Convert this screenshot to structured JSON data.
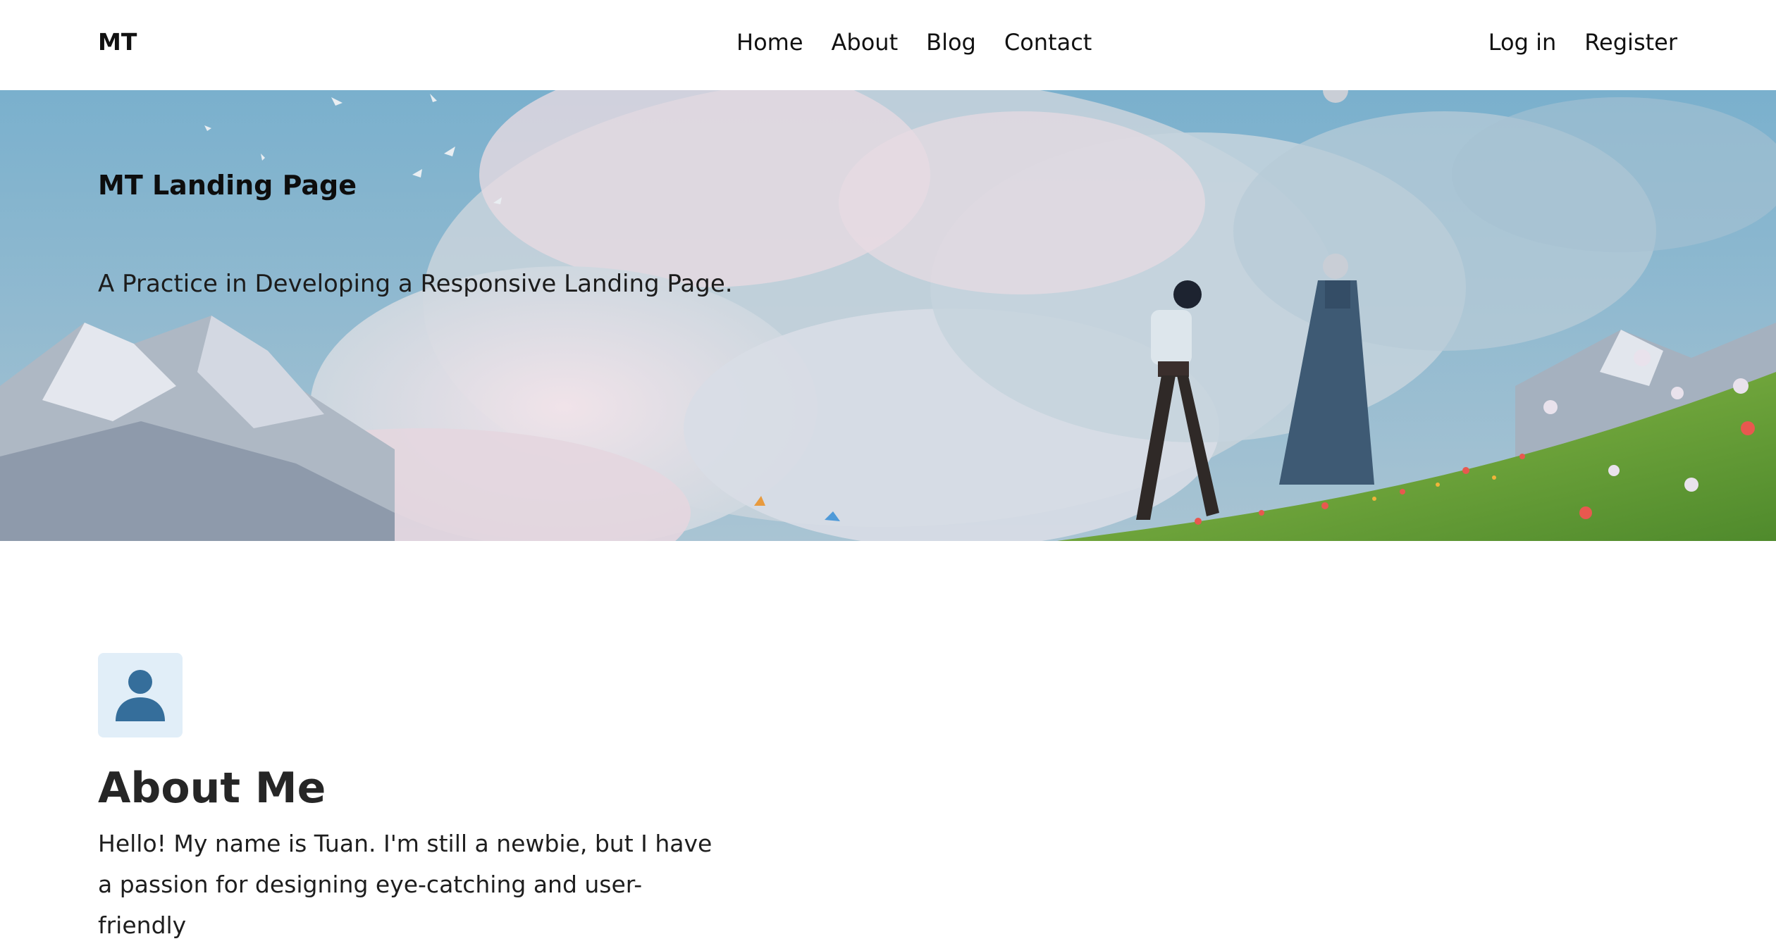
{
  "nav": {
    "brand": "MT",
    "links": [
      "Home",
      "About",
      "Blog",
      "Contact"
    ],
    "login": "Log in",
    "register": "Register"
  },
  "hero": {
    "title": "MT Landing Page",
    "subtitle": "A Practice in Developing a Responsive Landing Page."
  },
  "about": {
    "icon": "user-icon",
    "heading": "About Me",
    "text": "Hello! My name is Tuan. I'm still a newbie, but I have a passion for designing eye-catching and user-friendly"
  },
  "colors": {
    "sky": "#7fb1cf",
    "avatar_bg": "#e1eef8",
    "avatar_fg": "#356e9b"
  }
}
